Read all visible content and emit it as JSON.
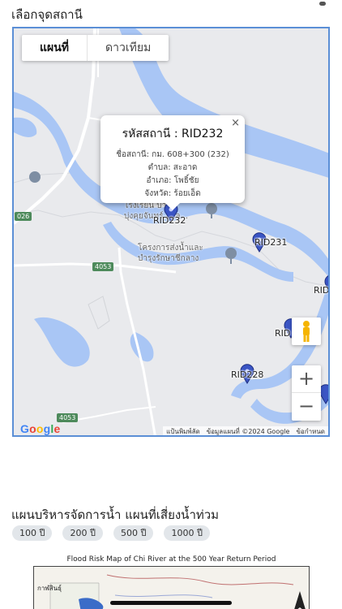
{
  "station_section": {
    "title": "เลือกจุดสถานี"
  },
  "map": {
    "tabs": [
      {
        "label": "แผนที่",
        "active": true
      },
      {
        "label": "ดาวเทียม",
        "active": false
      }
    ],
    "info_window": {
      "title": "รหัสสถานี : RID232",
      "station_name": "ชื่อสถานี: กม. 608+300 (232)",
      "subdistrict": "ตำบล: สะอาด",
      "district": "อำเภอ: โพธิ์ชัย",
      "province": "จังหวัด: ร้อยเอ็ด",
      "close_glyph": "×"
    },
    "markers": [
      {
        "label": "RID232"
      },
      {
        "label": "RID231"
      },
      {
        "label": "RID"
      },
      {
        "label": "RID"
      },
      {
        "label": "RID228"
      }
    ],
    "road_shields": [
      "026",
      "4053",
      "4053"
    ],
    "poi": {
      "school_line1": "โรงเรียน บ้าน",
      "school_line2": "บุ่งคุยจันทร์ สาล...",
      "project_line1": "โครงการส่งน้ำและ",
      "project_line2": "บำรุงรักษาชีกลาง"
    },
    "zoom_in": "+",
    "zoom_out": "−",
    "google_logo": [
      "G",
      "o",
      "o",
      "g",
      "l",
      "e"
    ],
    "attribution": {
      "shortcuts": "แป้นพิมพ์ลัด",
      "data": "ข้อมูลแผนที่ ©2024 Google",
      "terms": "ข้อกำหนด"
    },
    "colors": {
      "water": "#a9c6f5",
      "marker": "#3a55c4",
      "road_shield": "#4d8a5b",
      "frame": "#5b8fd6"
    }
  },
  "flood_section": {
    "title": "แผนบริหารจัดการน้ำ แผนที่เสี่ยงน้ำท่วม",
    "return_periods": [
      "100 ปี",
      "200 ปี",
      "500 ปี",
      "1000 ปี"
    ],
    "map_title": "Flood Risk Map of Chi River at the 500 Year Return Period",
    "map_place": "กาฬสินธุ์"
  }
}
